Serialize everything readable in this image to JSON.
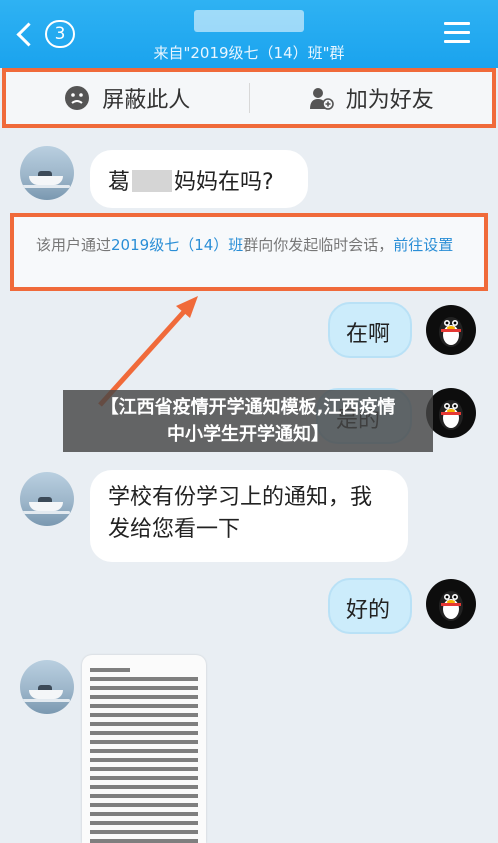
{
  "header": {
    "unread_count": "3",
    "subtitle": "来自\"2019级七（14）班\"群"
  },
  "actions": {
    "block_label": "屏蔽此人",
    "add_friend_label": "加为好友"
  },
  "messages": {
    "m1_prefix": "葛",
    "m1_suffix": "妈妈在吗?",
    "notice_text": "该用户通过",
    "notice_group": "2019级七（14）班",
    "notice_mid": "群向你发起临时会话，",
    "notice_link": "前往设置",
    "reply1": "在啊",
    "reply2_partial": "是的",
    "m2_line1": "学校有份学习上的通知，我",
    "m2_line2": "发给您看一下",
    "reply3": "好的"
  },
  "caption": {
    "line1": "【江西省疫情开学通知模板,江西疫情",
    "line2": "中小学生开学通知】"
  },
  "colors": {
    "header_blue": "#1aa3ee",
    "highlight_orange": "#f06a3a",
    "bubble_right": "#ccecfb"
  }
}
